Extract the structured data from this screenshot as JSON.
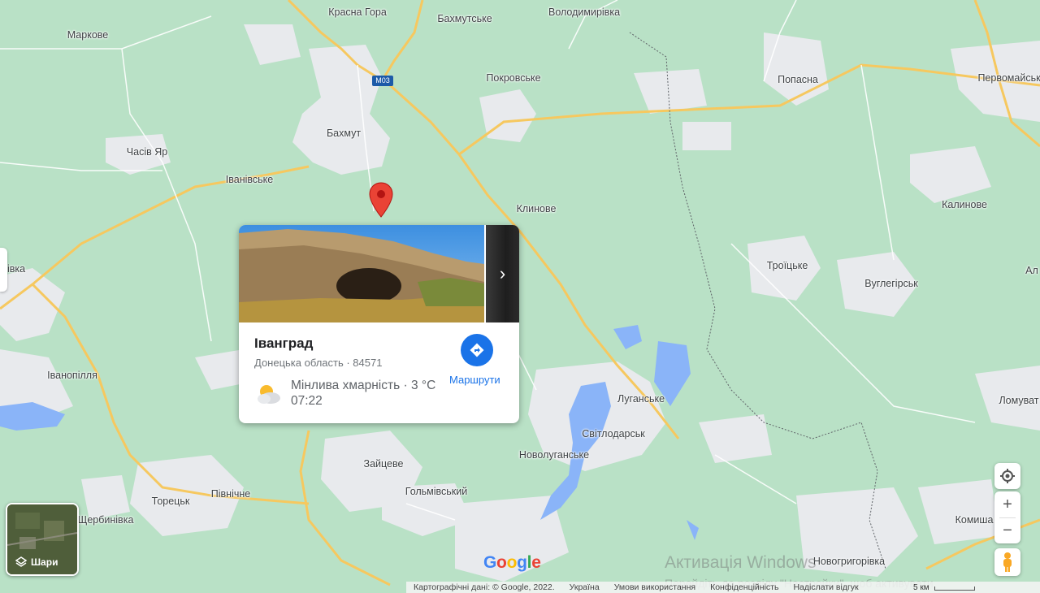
{
  "map": {
    "places": [
      {
        "name": "Красна Гора"
      },
      {
        "name": "Бахмутське"
      },
      {
        "name": "Володимирівка"
      },
      {
        "name": "Маркове"
      },
      {
        "name": "Покровське"
      },
      {
        "name": "Попасна"
      },
      {
        "name": "Первомайськ"
      },
      {
        "name": "Бахмут"
      },
      {
        "name": "Часів Яр"
      },
      {
        "name": "Іванівське"
      },
      {
        "name": "Клинове"
      },
      {
        "name": "Калинове"
      },
      {
        "name": "Троїцьке"
      },
      {
        "name": "Вуглегірськ"
      },
      {
        "name": "Ал"
      },
      {
        "name": "івка"
      },
      {
        "name": "Іванопілля"
      },
      {
        "name": "Луганське"
      },
      {
        "name": "Світлодарськ"
      },
      {
        "name": "Ломуват"
      },
      {
        "name": "Новолуганське"
      },
      {
        "name": "Зайцеве"
      },
      {
        "name": "Гольмівський"
      },
      {
        "name": "Торецьк"
      },
      {
        "name": "Північне"
      },
      {
        "name": "Щербинівка"
      },
      {
        "name": "Комиша"
      },
      {
        "name": "Новогригорівка"
      }
    ],
    "road_shield": "M03",
    "colors": {
      "land": "#b9e1c6",
      "urban": "#e8eaed",
      "water": "#8ab4f8",
      "highway": "#f6c85f",
      "pin": "#ea4335"
    }
  },
  "card": {
    "title": "Іванград",
    "subtitle": "Донецька область · 84571",
    "weather": "Мінлива хмарність · 3 °C",
    "time": "07:22",
    "directions_label": "Маршрути",
    "next_icon": "chevron-right-icon",
    "weather_icon": "partly-cloudy-icon"
  },
  "layers": {
    "label": "Шари"
  },
  "controls": {
    "locate_icon": "my-location-icon",
    "zoom_in": "+",
    "zoom_out": "−",
    "pegman_icon": "pegman-icon"
  },
  "logo": {
    "text": "Google"
  },
  "footer": {
    "map_data": "Картографічні дані: © Google, 2022.",
    "country": "Україна",
    "terms": "Умови використання",
    "privacy": "Конфіденційність",
    "feedback": "Надіслати відгук",
    "scale": "5 км"
  },
  "watermark": {
    "line1": "Активація Windows",
    "line2": "Перейдіть до розділу \"Настройки\", щоб активувати"
  }
}
